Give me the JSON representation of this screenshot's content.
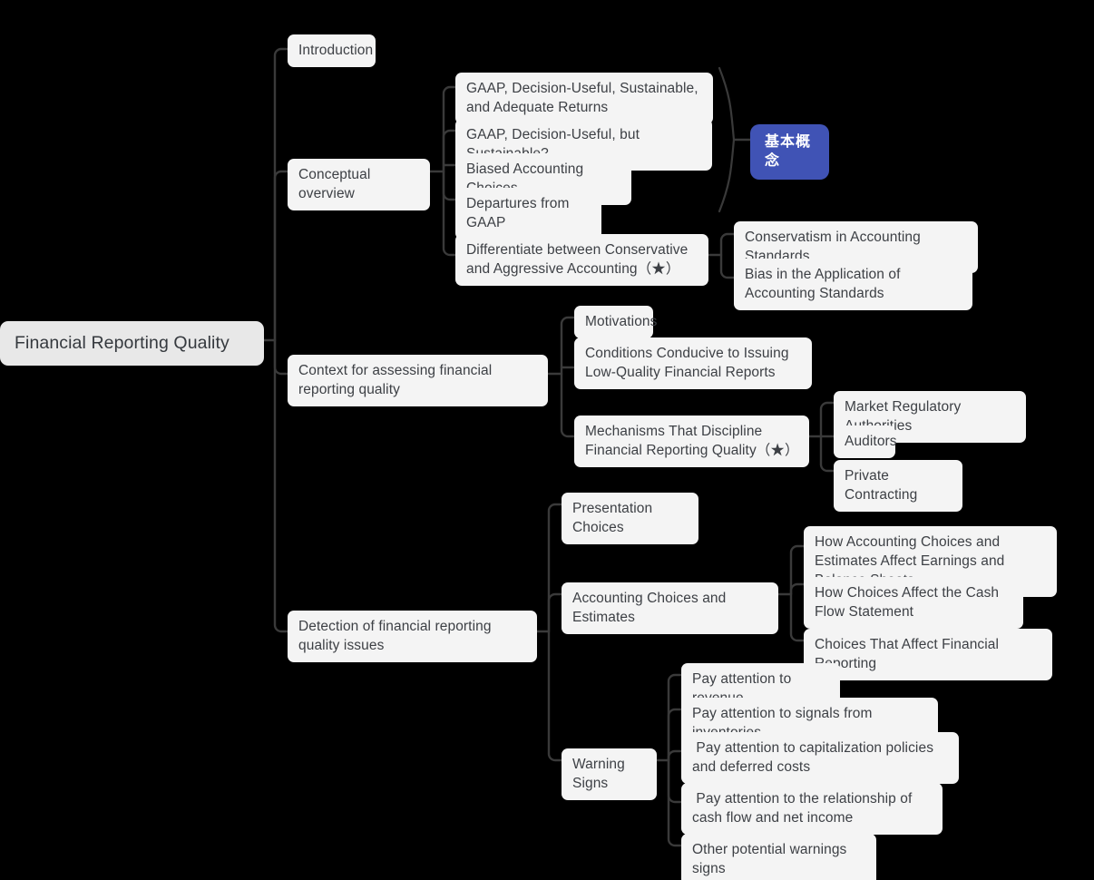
{
  "diagram": {
    "type": "mindmap",
    "background_color": "#000000",
    "node_color": "#f4f4f4",
    "root_color": "#e8e8e8",
    "text_color": "#3d4045",
    "accent_color": "#4053b5",
    "edge_color": "#3a3a3a"
  },
  "root": {
    "label": "Financial Reporting Quality"
  },
  "nodes": {
    "introduction": "Introduction",
    "conceptual_overview": "Conceptual overview",
    "gaap_sustainable_adequate": "GAAP, Decision-Useful, Sustainable, and Adequate Returns",
    "gaap_but_sustainable": "GAAP, Decision-Useful, but Sustainable?",
    "biased_accounting_choices": "Biased Accounting Choices",
    "departures_from_gaap": "Departures from GAAP",
    "basic_concepts_badge": "基本概念",
    "differentiate_conservative_aggressive": "Differentiate between Conservative and Aggressive Accounting（★）",
    "conservatism_in_standards": "Conservatism in Accounting Standards",
    "bias_in_application": "Bias in the Application of Accounting Standards",
    "context_for_assessing": "Context for assessing financial reporting quality",
    "motivations": "Motivations",
    "conditions_conducive": "Conditions Conducive to Issuing Low-Quality Financial Reports",
    "mechanisms_that_discipline": "Mechanisms That Discipline Financial Reporting Quality（★）",
    "market_regulatory_authorities": "Market Regulatory Authorities",
    "auditors": "Auditors",
    "private_contracting": "Private Contracting",
    "detection_of_issues": "Detection of financial reporting quality issues",
    "presentation_choices": "Presentation Choices",
    "accounting_choices_estimates": "Accounting Choices and Estimates",
    "how_choices_affect_earnings": "How Accounting Choices and Estimates Affect Earnings and Balance Sheets",
    "how_choices_affect_cashflow": "How Choices Affect the Cash Flow Statement",
    "choices_that_affect_reporting": "Choices That Affect Financial Reporting",
    "warning_signs": "Warning Signs",
    "pay_attention_revenue": "Pay attention to revenue",
    "pay_attention_inventories": "Pay attention to signals from inventories",
    "pay_attention_capitalization": " Pay attention to capitalization policies and deferred costs",
    "pay_attention_cashflow_netincome": " Pay attention to the relationship of cash flow and net income",
    "other_potential_warnings": "Other potential warnings signs"
  }
}
